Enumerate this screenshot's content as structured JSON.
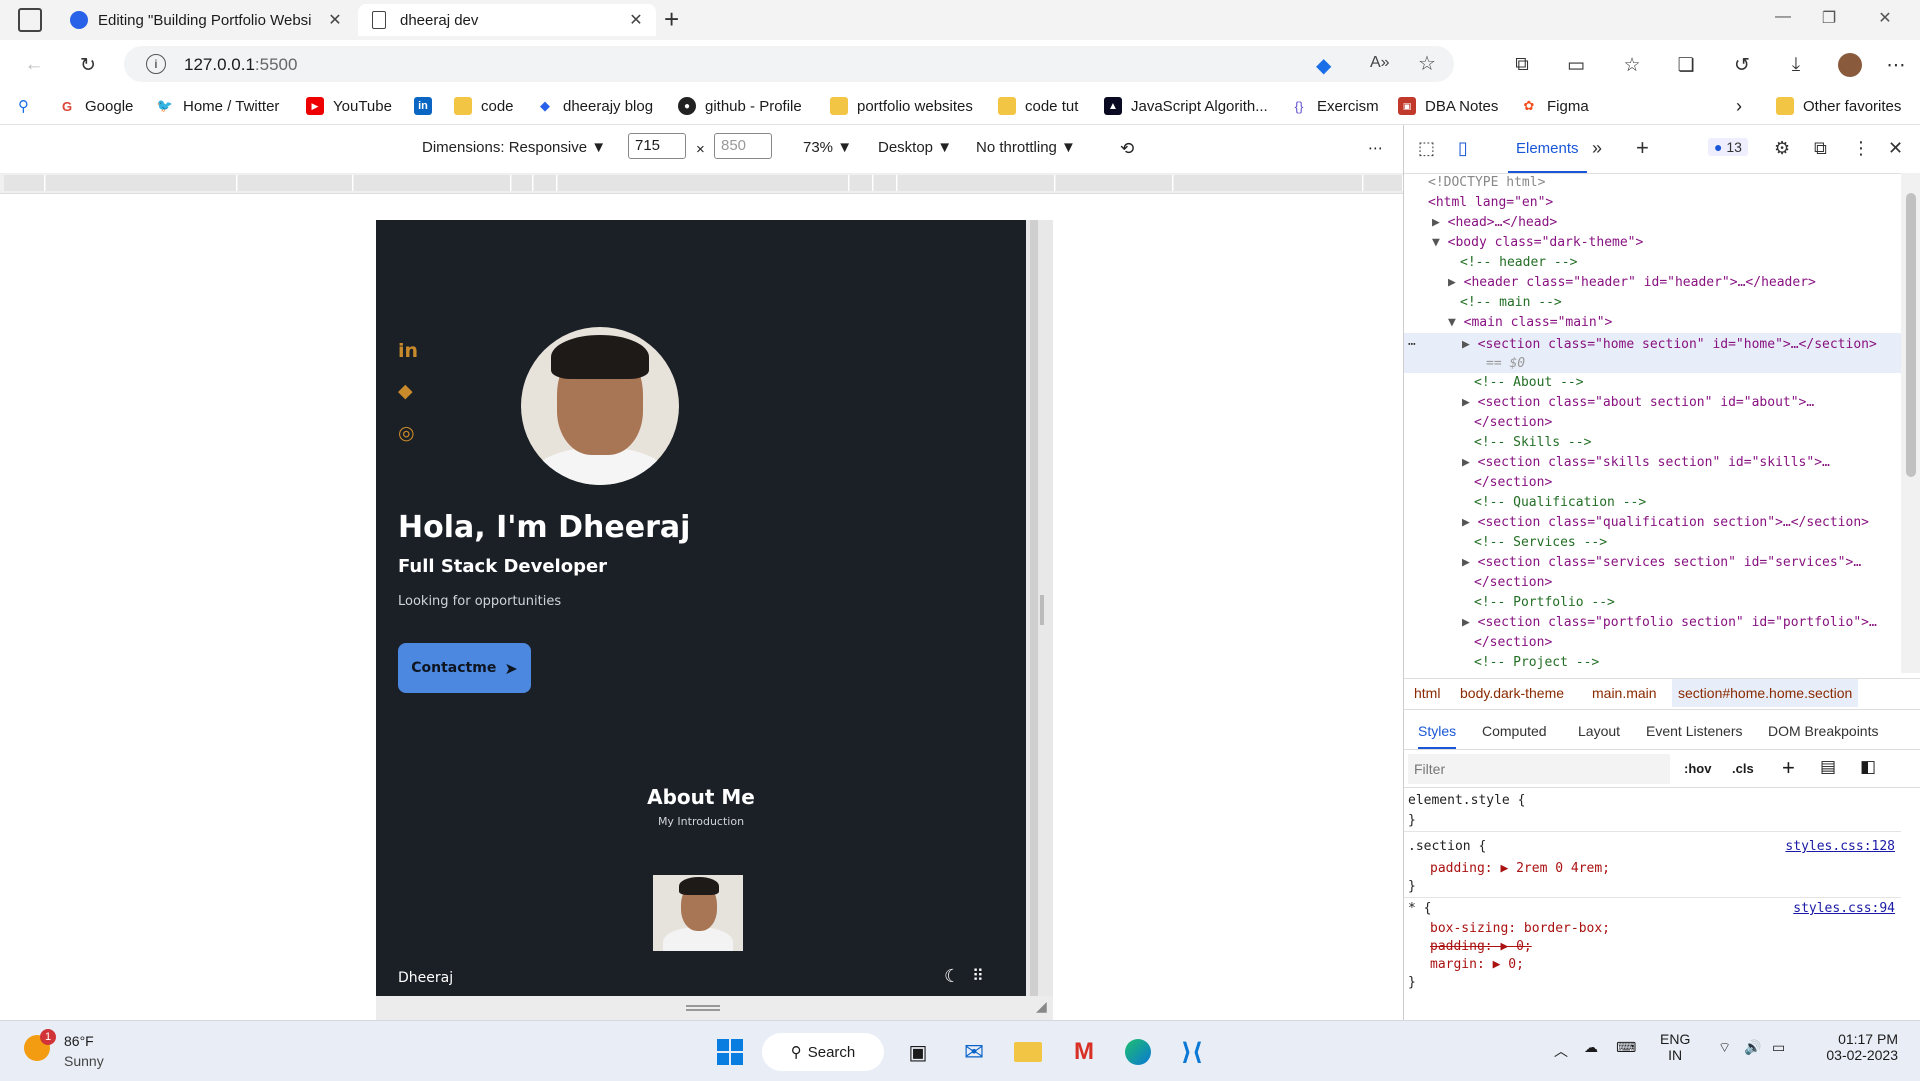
{
  "browser": {
    "tabs": [
      {
        "label": "Editing \"Building Portfolio Websi",
        "active": false
      },
      {
        "label": "dheeraj dev",
        "active": true
      }
    ],
    "address": {
      "host": "127.0.0.1",
      "port": ":5500"
    },
    "bookmarks": [
      {
        "label": "Google"
      },
      {
        "label": "Home / Twitter"
      },
      {
        "label": "YouTube"
      },
      {
        "label": "code"
      },
      {
        "label": "dheerajy blog"
      },
      {
        "label": "github - Profile"
      },
      {
        "label": "portfolio websites"
      },
      {
        "label": "code tut"
      },
      {
        "label": "JavaScript Algorith..."
      },
      {
        "label": "Exercism"
      },
      {
        "label": "DBA Notes"
      },
      {
        "label": "Figma"
      }
    ],
    "other_favorites": "Other favorites"
  },
  "device_toolbar": {
    "dimensions_label": "Dimensions: Responsive",
    "width": "715",
    "height": "850",
    "zoom": "73%",
    "device": "Desktop",
    "throttling": "No throttling"
  },
  "page": {
    "hero_title": "Hola, I'm Dheeraj",
    "hero_subtitle": "Full Stack Developer",
    "hero_description": "Looking for opportunities",
    "contact_button": "Contactme",
    "about_title": "About Me",
    "about_subtitle": "My Introduction",
    "footer_name": "Dheeraj"
  },
  "devtools": {
    "elements_tab": "Elements",
    "issues_count": "13",
    "dom_lines": [
      {
        "text": "<!DOCTYPE html>"
      },
      {
        "text": "<html lang=\"en\">"
      },
      {
        "text": "<head>…</head>"
      },
      {
        "text": "<body class=\"dark-theme\">"
      },
      {
        "text": "<!-- header -->"
      },
      {
        "text": "<header class=\"header\" id=\"header\">…</header>"
      },
      {
        "text": "<!-- main -->"
      },
      {
        "text": "<main class=\"main\">"
      },
      {
        "text": "<section class=\"home section\" id=\"home\">…</section>"
      },
      {
        "text": "== $0"
      },
      {
        "text": "<!-- About -->"
      },
      {
        "text": "<section class=\"about section\" id=\"about\">…"
      },
      {
        "text": "</section>"
      },
      {
        "text": "<!-- Skills -->"
      },
      {
        "text": "<section class=\"skills section\" id=\"skills\">…"
      },
      {
        "text": "</section>"
      },
      {
        "text": "<!-- Qualification -->"
      },
      {
        "text": "<section class=\"qualification section\">…</section>"
      },
      {
        "text": "<!-- Services -->"
      },
      {
        "text": "<section class=\"services section\" id=\"services\">…"
      },
      {
        "text": "</section>"
      },
      {
        "text": "<!-- Portfolio -->"
      },
      {
        "text": "<section class=\"portfolio section\" id=\"portfolio\">…"
      },
      {
        "text": "</section>"
      },
      {
        "text": "<!-- Project -->"
      }
    ],
    "breadcrumbs": [
      "html",
      "body.dark-theme",
      "main.main",
      "section#home.home.section"
    ],
    "style_tabs": [
      "Styles",
      "Computed",
      "Layout",
      "Event Listeners",
      "DOM Breakpoints"
    ],
    "filter_placeholder": "Filter",
    "hov": ":hov",
    "cls": ".cls",
    "rules": {
      "element_style": "element.style {",
      "close": "}",
      "section_selector": ".section {",
      "section_source": "styles.css:128",
      "padding_line": "padding: ▶ 2rem 0 4rem;",
      "star_selector": "* {",
      "star_source": "styles.css:94",
      "box_sizing": "box-sizing: border-box;",
      "padding_struck": "padding: ▶ 0;",
      "margin": "margin: ▶ 0;"
    }
  },
  "taskbar": {
    "weather_temp": "86°F",
    "weather_desc": "Sunny",
    "weather_badge": "1",
    "search": "Search",
    "lang": "ENG",
    "region": "IN",
    "time": "01:17 PM",
    "date": "03-02-2023"
  }
}
